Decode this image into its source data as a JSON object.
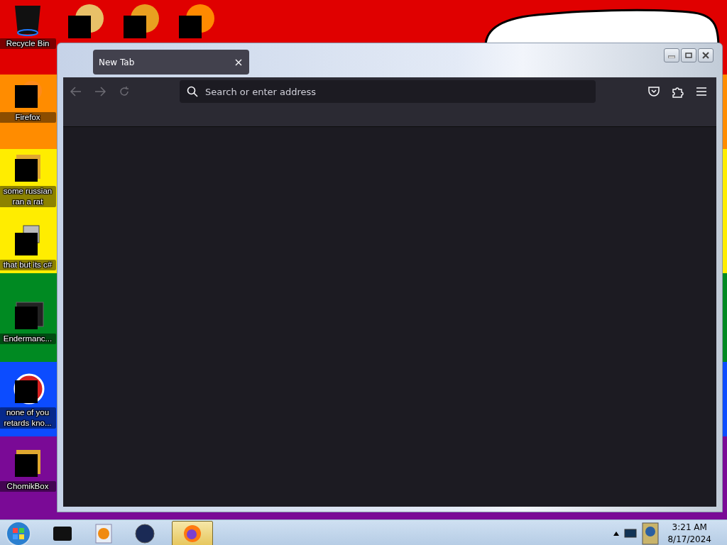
{
  "desktop_icons": [
    {
      "label": "Recycle Bin",
      "kind": "bin"
    },
    {
      "label": "Firefox",
      "kind": "fox"
    },
    {
      "label": "some russian ran a rat",
      "kind": "tile"
    },
    {
      "label": "that but its c#",
      "kind": "stack"
    },
    {
      "label": "Endermanc...",
      "kind": "window"
    },
    {
      "label": "none of you retards kno...",
      "kind": "ring"
    },
    {
      "label": "ChomikBox",
      "kind": "tile"
    }
  ],
  "browser": {
    "tabs": [
      {
        "label": "New Tab",
        "selected": true
      }
    ],
    "address_bar": {
      "placeholder": "Search or enter address"
    }
  },
  "taskbar": {
    "apps": [
      {
        "selected": false
      },
      {
        "selected": false
      },
      {
        "selected": false
      },
      {
        "selected": true
      }
    ],
    "clock": {
      "time": "3:21 AM",
      "date": "8/17/2024"
    }
  }
}
